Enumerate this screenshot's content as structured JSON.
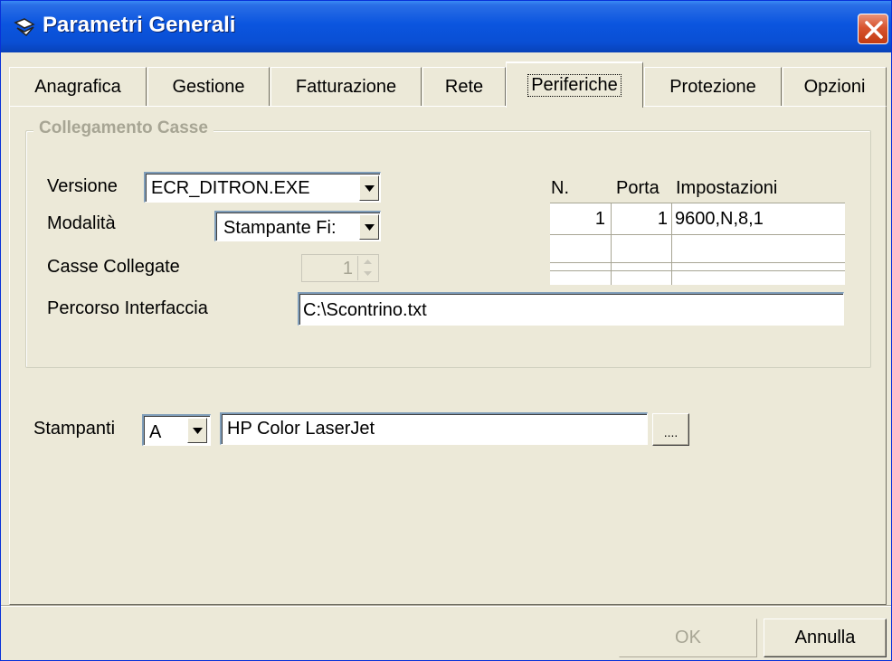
{
  "window": {
    "title": "Parametri Generali"
  },
  "tabs": [
    {
      "label": "Anagrafica"
    },
    {
      "label": "Gestione"
    },
    {
      "label": "Fatturazione"
    },
    {
      "label": "Rete"
    },
    {
      "label": "Periferiche"
    },
    {
      "label": "Protezione"
    },
    {
      "label": "Opzioni"
    }
  ],
  "active_tab": "Periferiche",
  "group": {
    "legend": "Collegamento Casse",
    "versione": {
      "label": "Versione",
      "value": "ECR_DITRON.EXE"
    },
    "modalita": {
      "label": "Modalità",
      "value": "Stampante Fi:"
    },
    "casse_collegate": {
      "label": "Casse Collegate",
      "value": "1"
    },
    "percorso": {
      "label": "Percorso Interfaccia",
      "value": "C:\\Scontrino.txt"
    },
    "grid": {
      "headers": [
        "N.",
        "Porta",
        "Impostazioni"
      ],
      "rows": [
        [
          "1",
          "1",
          "9600,N,8,1"
        ],
        [
          "",
          "",
          ""
        ],
        [
          "",
          "",
          ""
        ]
      ]
    }
  },
  "stampanti": {
    "label": "Stampanti",
    "letter": "A",
    "printer": "HP Color LaserJet",
    "browse_label": "...."
  },
  "buttons": {
    "ok": "OK",
    "cancel": "Annulla"
  }
}
